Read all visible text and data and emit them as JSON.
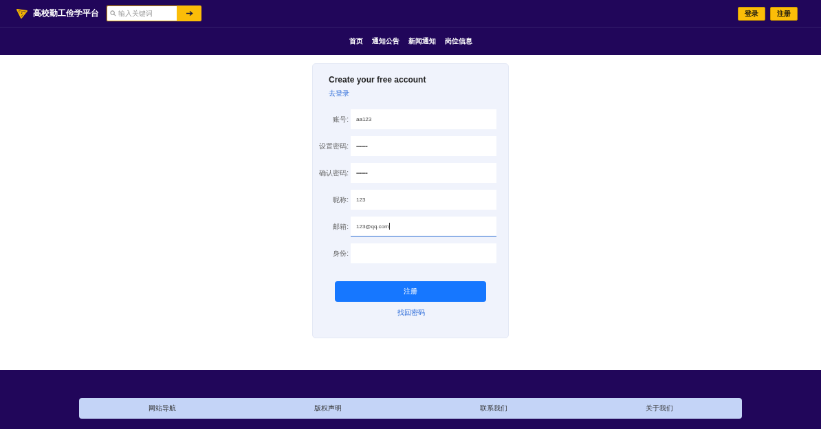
{
  "header": {
    "site_title": "高校勤工俭学平台",
    "search": {
      "placeholder": "输入关键词"
    },
    "buttons": [
      "登录",
      "注册"
    ]
  },
  "nav": [
    "首页",
    "通知公告",
    "新闻通知",
    "岗位信息"
  ],
  "form": {
    "title": "Create your free account",
    "login_link": "去登录",
    "fields": [
      {
        "label": "账号:",
        "value": "aa123",
        "focused": false
      },
      {
        "label": "设置密码:",
        "value": "••••••",
        "focused": false
      },
      {
        "label": "确认密码:",
        "value": "••••••",
        "focused": false
      },
      {
        "label": "昵称:",
        "value": "123",
        "focused": false
      },
      {
        "label": "邮箱:",
        "value": "123@qq.com",
        "focused": true
      },
      {
        "label": "身份:",
        "focused": false
      }
    ],
    "submit": "注册",
    "recover_link": "找回密码"
  },
  "footer": {
    "links": [
      "网站导航",
      "版权声明",
      "联系我们",
      "关于我们"
    ]
  }
}
